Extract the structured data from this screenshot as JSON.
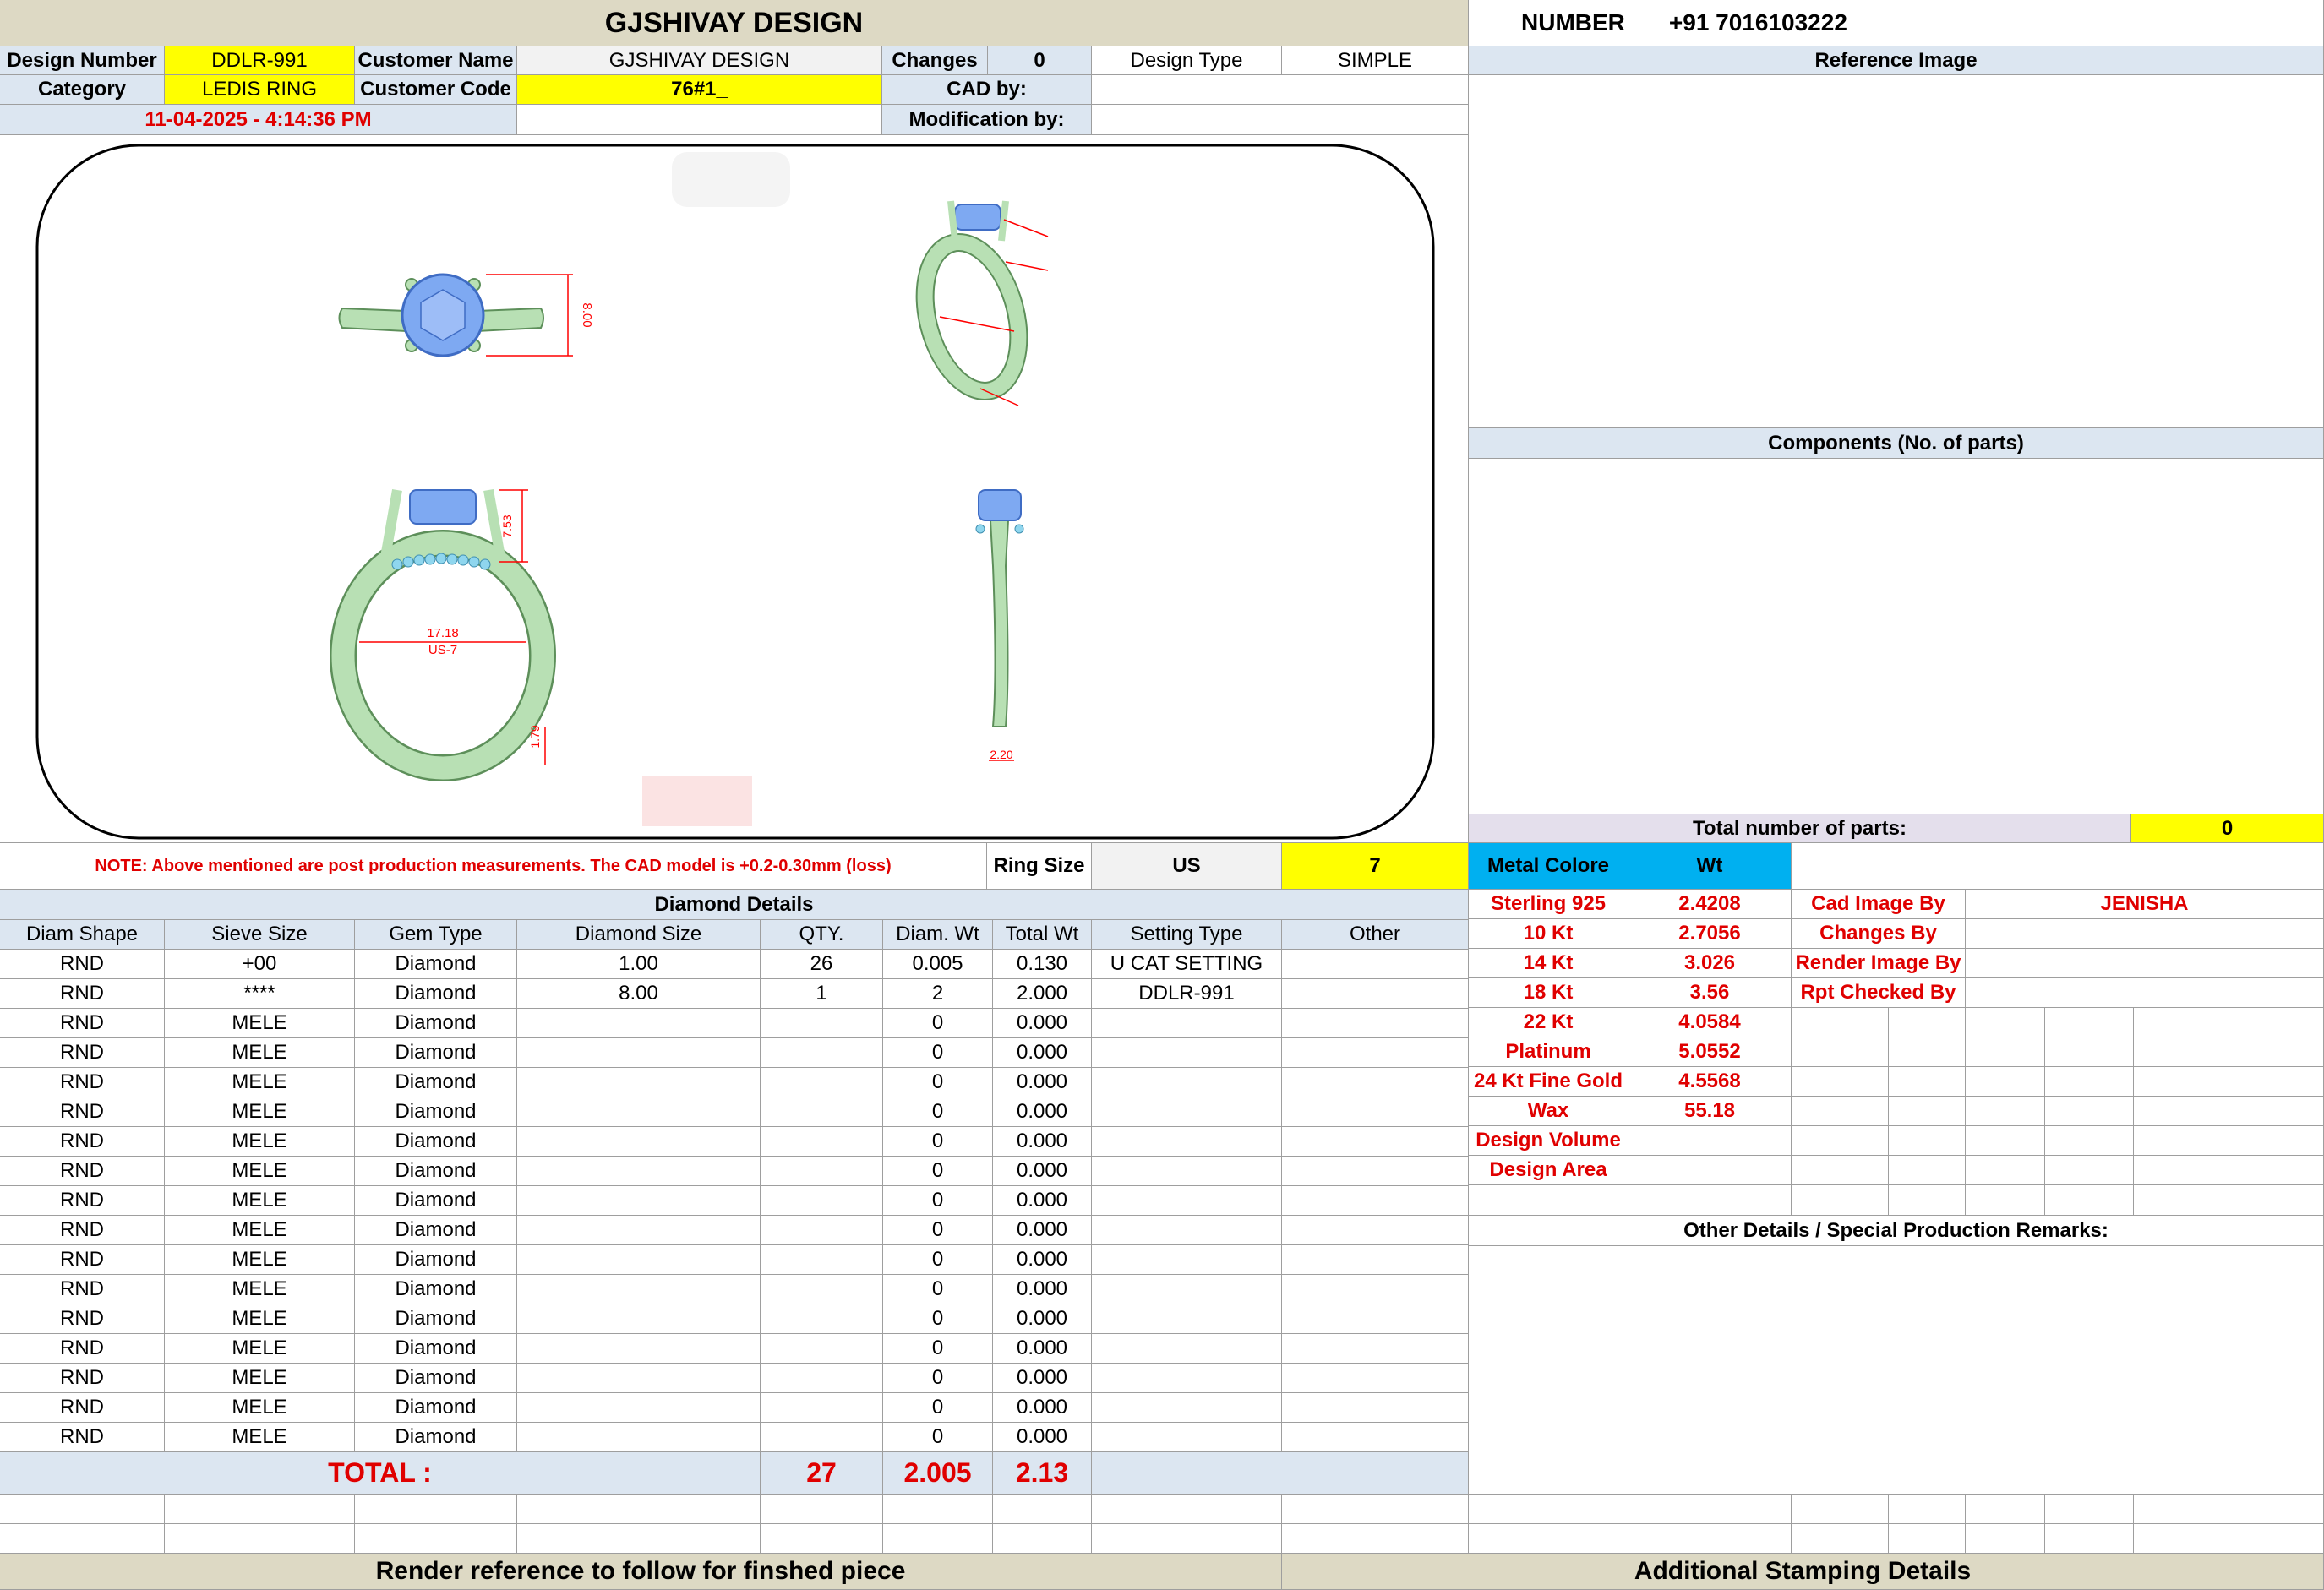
{
  "header": {
    "title": "GJSHIVAY DESIGN",
    "number_label": "NUMBER",
    "number_value": "+91 7016103222",
    "design_number_label": "Design Number",
    "design_number": "DDLR-991",
    "customer_name_label": "Customer Name",
    "customer_name": "GJSHIVAY DESIGN",
    "changes_label": "Changes",
    "changes": "0",
    "design_type_label": "Design Type",
    "design_type": "SIMPLE",
    "category_label": "Category",
    "category": "LEDIS RING",
    "customer_code_label": "Customer Code",
    "customer_code": "76#1_",
    "cad_by_label": "CAD by:",
    "modification_by_label": "Modification by:",
    "datetime": "11-04-2025 - 4:14:36 PM"
  },
  "drawing": {
    "dim_top_height": "8.00",
    "dim_inner_diameter": "17.18",
    "dim_ring_size": "US-7",
    "dim_setting_height": "7.53",
    "dim_band_bottom": "1.79",
    "dim_band_width": "2.20",
    "colors": {
      "metal": "#b8e0b4",
      "metal_dark": "#5d8f5a",
      "stone": "#7ea9f2",
      "stone_dark": "#3f6cc4",
      "dimension": "#ff0000",
      "small_stones": "#8fd6ee"
    }
  },
  "reference": {
    "title": "Reference Image"
  },
  "components": {
    "title": "Components (No. of parts)",
    "total_label": "Total number of parts:",
    "total_value": "0"
  },
  "note": "NOTE: Above mentioned are post production measurements. The CAD model is +0.2-0.30mm (loss)",
  "ring_size": {
    "label": "Ring Size",
    "unit": "US",
    "value": "7"
  },
  "metal": {
    "label": "Metal Colore",
    "wt_label": "Wt",
    "rows": [
      {
        "name": "Sterling 925",
        "wt": "2.4208"
      },
      {
        "name": "10 Kt",
        "wt": "2.7056"
      },
      {
        "name": "14 Kt",
        "wt": "3.026"
      },
      {
        "name": "18 Kt",
        "wt": "3.56"
      },
      {
        "name": "22 Kt",
        "wt": "4.0584"
      },
      {
        "name": "Platinum",
        "wt": "5.0552"
      },
      {
        "name": "24 Kt Fine Gold",
        "wt": "4.5568"
      },
      {
        "name": "Wax",
        "wt": "55.18"
      },
      {
        "name": "Design Volume",
        "wt": ""
      },
      {
        "name": "Design Area",
        "wt": ""
      }
    ]
  },
  "credits": [
    {
      "label": "Cad Image By",
      "value": "JENISHA"
    },
    {
      "label": "Changes By",
      "value": ""
    },
    {
      "label": "Render Image By",
      "value": ""
    },
    {
      "label": "Rpt Checked By",
      "value": ""
    }
  ],
  "diamond": {
    "title": "Diamond Details",
    "headers": [
      "Diam Shape",
      "Sieve Size",
      "Gem Type",
      "Diamond Size",
      "QTY.",
      "Diam. Wt",
      "Total Wt",
      "Setting Type",
      "Other"
    ],
    "rows": [
      [
        "RND",
        "+00",
        "Diamond",
        "1.00",
        "26",
        "0.005",
        "0.130",
        "U CAT SETTING",
        ""
      ],
      [
        "RND",
        "****",
        "Diamond",
        "8.00",
        "1",
        "2",
        "2.000",
        "DDLR-991",
        ""
      ],
      [
        "RND",
        "MELE",
        "Diamond",
        "",
        "",
        "0",
        "0.000",
        "",
        ""
      ],
      [
        "RND",
        "MELE",
        "Diamond",
        "",
        "",
        "0",
        "0.000",
        "",
        ""
      ],
      [
        "RND",
        "MELE",
        "Diamond",
        "",
        "",
        "0",
        "0.000",
        "",
        ""
      ],
      [
        "RND",
        "MELE",
        "Diamond",
        "",
        "",
        "0",
        "0.000",
        "",
        ""
      ],
      [
        "RND",
        "MELE",
        "Diamond",
        "",
        "",
        "0",
        "0.000",
        "",
        ""
      ],
      [
        "RND",
        "MELE",
        "Diamond",
        "",
        "",
        "0",
        "0.000",
        "",
        ""
      ],
      [
        "RND",
        "MELE",
        "Diamond",
        "",
        "",
        "0",
        "0.000",
        "",
        ""
      ],
      [
        "RND",
        "MELE",
        "Diamond",
        "",
        "",
        "0",
        "0.000",
        "",
        ""
      ],
      [
        "RND",
        "MELE",
        "Diamond",
        "",
        "",
        "0",
        "0.000",
        "",
        ""
      ],
      [
        "RND",
        "MELE",
        "Diamond",
        "",
        "",
        "0",
        "0.000",
        "",
        ""
      ],
      [
        "RND",
        "MELE",
        "Diamond",
        "",
        "",
        "0",
        "0.000",
        "",
        ""
      ],
      [
        "RND",
        "MELE",
        "Diamond",
        "",
        "",
        "0",
        "0.000",
        "",
        ""
      ],
      [
        "RND",
        "MELE",
        "Diamond",
        "",
        "",
        "0",
        "0.000",
        "",
        ""
      ],
      [
        "RND",
        "MELE",
        "Diamond",
        "",
        "",
        "0",
        "0.000",
        "",
        ""
      ],
      [
        "RND",
        "MELE",
        "Diamond",
        "",
        "",
        "0",
        "0.000",
        "",
        ""
      ]
    ],
    "total_label": "TOTAL :",
    "total_qty": "27",
    "total_diam_wt": "2.005",
    "total_wt": "2.13"
  },
  "other_details": {
    "title": "Other Details / Special Production Remarks:"
  },
  "footer": {
    "render_note": "Render reference to follow for finshed piece",
    "stamping": "Additional Stamping Details"
  }
}
